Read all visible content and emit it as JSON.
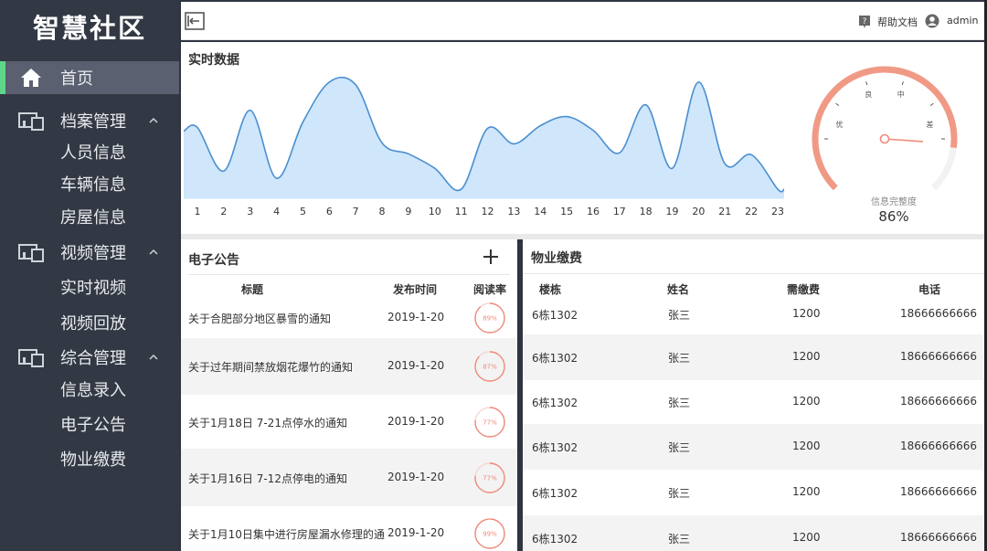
{
  "sidebar": {
    "brand": "智慧社区",
    "home": "首页",
    "groups": [
      {
        "label": "档案管理",
        "items": [
          "人员信息",
          "车辆信息",
          "房屋信息"
        ]
      },
      {
        "label": "视频管理",
        "items": [
          "实时视频",
          "视频回放"
        ]
      },
      {
        "label": "综合管理",
        "items": [
          "信息录入",
          "电子公告",
          "物业缴费"
        ]
      }
    ]
  },
  "topbar": {
    "help": "帮助文档",
    "user": "admin"
  },
  "realtime": {
    "title": "实时数据",
    "gauge": {
      "labels": [
        "优",
        "良",
        "中",
        "差"
      ],
      "caption": "信息完整度",
      "value": "86%",
      "percent": 86
    }
  },
  "chart_data": {
    "type": "area",
    "title": "实时数据",
    "x": [
      1,
      2,
      3,
      4,
      5,
      6,
      7,
      8,
      9,
      10,
      11,
      12,
      13,
      14,
      15,
      16,
      17,
      18,
      19,
      20,
      21,
      22,
      23
    ],
    "values": [
      78,
      30,
      97,
      22,
      84,
      128,
      125,
      61,
      49,
      33,
      10,
      77,
      60,
      80,
      90,
      75,
      50,
      103,
      33,
      128,
      38,
      48,
      10
    ],
    "ylim": [
      0,
      150
    ],
    "color": "#4a8fd0",
    "fill": "#cfe6fb"
  },
  "notice": {
    "title": "电子公告",
    "headers": [
      "标题",
      "发布时间",
      "阅读率"
    ],
    "rows": [
      {
        "title": "关于合肥部分地区暴雪的通知",
        "date": "2019-1-20",
        "rate": "89%",
        "pct": 89
      },
      {
        "title": "关于过年期间禁放烟花爆竹的通知",
        "date": "2019-1-20",
        "rate": "87%",
        "pct": 87
      },
      {
        "title": "关于1月18日 7-21点停水的通知",
        "date": "2019-1-20",
        "rate": "77%",
        "pct": 77
      },
      {
        "title": "关于1月16日 7-12点停电的通知",
        "date": "2019-1-20",
        "rate": "77%",
        "pct": 77
      },
      {
        "title": "关于1月10日集中进行房屋漏水修理的通",
        "date": "2019-1-20",
        "rate": "99%",
        "pct": 99
      }
    ]
  },
  "fee": {
    "title": "物业缴费",
    "headers": [
      "楼栋",
      "姓名",
      "需缴费",
      "电话"
    ],
    "rows": [
      {
        "building": "6栋1302",
        "name": "张三",
        "fee": "1200",
        "phone": "18666666666"
      },
      {
        "building": "6栋1302",
        "name": "张三",
        "fee": "1200",
        "phone": "18666666666"
      },
      {
        "building": "6栋1302",
        "name": "张三",
        "fee": "1200",
        "phone": "18666666666"
      },
      {
        "building": "6栋1302",
        "name": "张三",
        "fee": "1200",
        "phone": "18666666666"
      },
      {
        "building": "6栋1302",
        "name": "张三",
        "fee": "1200",
        "phone": "18666666666"
      },
      {
        "building": "6栋1302",
        "name": "张三",
        "fee": "1200",
        "phone": "18666666666"
      }
    ]
  },
  "colors": {
    "accent": "#5fd58a",
    "gauge": "#f09a86",
    "ring": "#f08b7a"
  }
}
